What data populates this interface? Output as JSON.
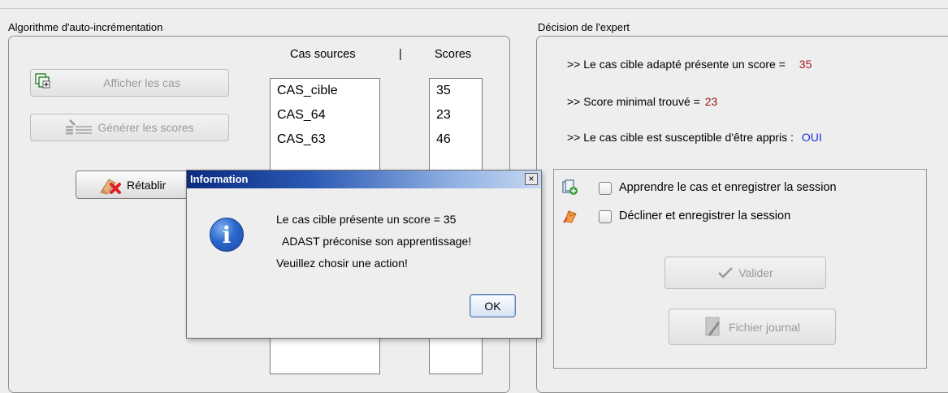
{
  "left_panel": {
    "title": "Algorithme d'auto-incrémentation",
    "cases_header": "Cas sources",
    "separator": "|",
    "scores_header": "Scores",
    "show_cases_label": "Afficher les cas",
    "generate_scores_label": "Générer les scores",
    "reset_label": "Rétablir",
    "cases": [
      "CAS_cible",
      "CAS_64",
      "CAS_63"
    ],
    "scores": [
      "35",
      "23",
      "46"
    ]
  },
  "right_panel": {
    "title": "Décision de l'expert",
    "line1_label": ">> Le cas cible adapté présente un score =",
    "line1_value": "35",
    "line2_label": ">> Score minimal trouvé =",
    "line2_value": "23",
    "line3_label": ">> Le cas cible est susceptible d'être appris :",
    "line3_value": "OUI",
    "learn_checkbox_label": "Apprendre le cas et enregistrer la session",
    "decline_checkbox_label": "Décliner et enregistrer la session",
    "validate_label": "Valider",
    "journal_label": "Fichier journal"
  },
  "dialog": {
    "title": "Information",
    "close_glyph": "×",
    "info_glyph": "i",
    "line1": "Le cas cible présente un score = 35",
    "line2": "ADAST préconise son apprentissage!",
    "line3": "Veuillez chosir une action!",
    "ok_label": "OK"
  },
  "colors": {
    "value_red": "#a01818",
    "value_blue": "#1a2cd8",
    "dialog_title_start": "#0b2a80",
    "dialog_title_end": "#c6d8f2"
  }
}
